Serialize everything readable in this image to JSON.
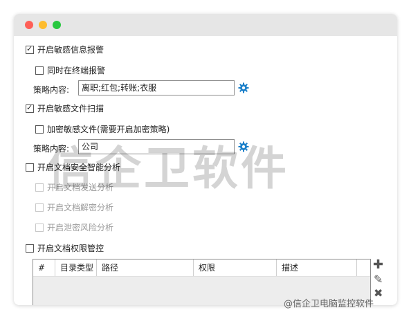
{
  "window": {
    "title": ""
  },
  "options": {
    "sensitive_info_alert": {
      "label": "开启敏感信息报警",
      "checked": true
    },
    "terminal_alert": {
      "label": "同时在终端报警",
      "checked": false
    },
    "policy1_label": "策略内容:",
    "policy1_value": "离职;红包;转账;衣服",
    "sensitive_file_scan": {
      "label": "开启敏感文件扫描",
      "checked": true
    },
    "encrypt_sensitive": {
      "label": "加密敏感文件(需要开启加密策略)",
      "checked": false
    },
    "policy2_label": "策略内容:",
    "policy2_value": "公司",
    "doc_security_analysis": {
      "label": "开启文档安全智能分析",
      "checked": false
    },
    "doc_send_analysis": {
      "label": "开启文档发送分析",
      "checked": false
    },
    "doc_decrypt_analysis": {
      "label": "开启文档解密分析",
      "checked": false
    },
    "leak_risk_analysis": {
      "label": "开启泄密风险分析",
      "checked": false
    },
    "doc_permission_control": {
      "label": "开启文档权限管控",
      "checked": false
    }
  },
  "table": {
    "headers": [
      "#",
      "目录类型",
      "路径",
      "权限",
      "描述"
    ]
  },
  "icons": {
    "gear": "gear-icon",
    "add": "plus-icon",
    "edit": "pencil-icon",
    "delete": "close-icon"
  },
  "watermark_text": "信企卫软件",
  "footer_watermark": "@信企卫电脑监控软件",
  "colors": {
    "gear": "#1a7fc9",
    "accent_red": "#fe5f57",
    "accent_yellow": "#febc2e",
    "accent_green": "#28c840"
  }
}
